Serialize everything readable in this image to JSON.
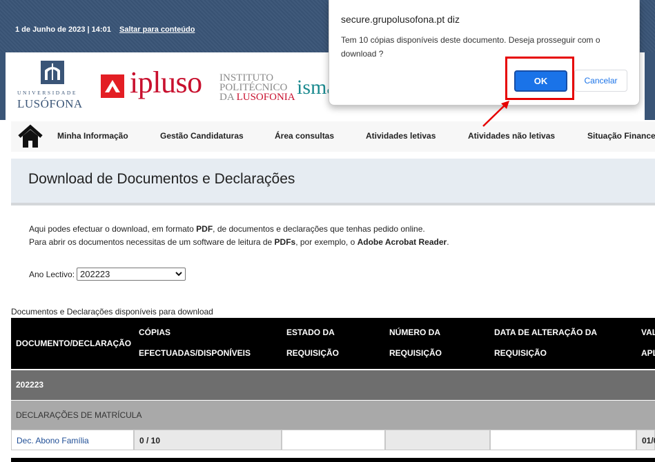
{
  "topbar": {
    "date": "1 de Junho de 2023 | 14:01",
    "skip_link": "Saltar para conteúdo"
  },
  "logos": {
    "universidade_line1": "UNIVERSIDADE",
    "universidade_line2": "LUSÓFONA",
    "ipluso": "ipluso",
    "ipl_line1": "INSTITUTO",
    "ipl_line2": "POLITÉCNICO",
    "ipl_line3_prefix": "DA ",
    "ipl_line3_red": "LUSOFONIA",
    "isma": "isma"
  },
  "nav": {
    "home_icon": "home-icon",
    "items": [
      "Minha Informação",
      "Gestão Candidaturas",
      "Área consultas",
      "Atividades letivas",
      "Atividades não letivas",
      "Situação Financeira"
    ]
  },
  "page": {
    "title": "Download de Documentos e Declarações",
    "intro_line1_a": "Aqui podes efectuar o download, em formato ",
    "intro_line1_b": "PDF",
    "intro_line1_c": ", de documentos e declarações que tenhas pedido online.",
    "intro_line2_a": "Para abrir os documentos necessitas de um software de leitura de ",
    "intro_line2_b": "PDFs",
    "intro_line2_c": ", por exemplo, o ",
    "intro_line2_d": "Adobe Acrobat Reader",
    "intro_line2_e": ".",
    "ano_label": "Ano Lectivo:",
    "ano_value": "202223",
    "table_caption": "Documentos e Declarações disponíveis para download"
  },
  "table": {
    "headers": [
      {
        "line1": "DOCUMENTO/DECLARAÇÃO",
        "line2": ""
      },
      {
        "line1": "CÓPIAS",
        "line2": "EFECTUADAS/DISPONÍVEIS"
      },
      {
        "line1": "ESTADO DA",
        "line2": "REQUISIÇÃO"
      },
      {
        "line1": "NÚMERO DA",
        "line2": "REQUISIÇÃO"
      },
      {
        "line1": "DATA DE ALTERAÇÃO DA",
        "line2": "REQUISIÇÃO"
      },
      {
        "line1": "VAL",
        "line2": "APL"
      }
    ],
    "year_row": "202223",
    "category_row": "DECLARAÇÕES DE MATRÍCULA",
    "data_row": {
      "document": "Dec. Abono Família",
      "copies": "0 / 10",
      "estado": "",
      "numero": "",
      "data": "",
      "validade": "01/0"
    }
  },
  "dialog": {
    "title": "secure.grupolusofona.pt diz",
    "message": "Tem 10 cópias disponíveis deste documento. Deseja prosseguir com o download ?",
    "ok_label": "OK",
    "cancel_label": "Cancelar"
  },
  "colors": {
    "header_blue": "#3a5577",
    "ok_blue": "#1a73e8",
    "highlight_red": "#e60000"
  }
}
